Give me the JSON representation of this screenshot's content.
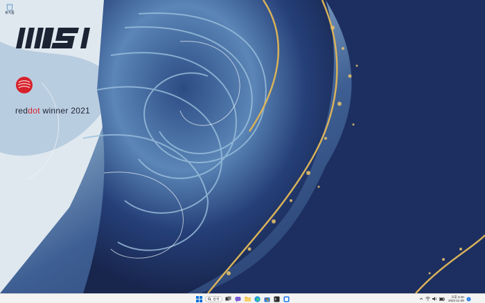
{
  "desktop": {
    "icons": [
      {
        "label": "휴지통",
        "icon": "recycle-bin-icon"
      }
    ],
    "wallpaper": {
      "brand_logo": "MSI",
      "award_text_prefix": "red",
      "award_text_highlight": "dot",
      "award_text_suffix": " winner 2021",
      "colors": {
        "navy": "#1d2f60",
        "gold": "#d9b25a",
        "brand_dark": "#1c2333",
        "red": "#d7212b"
      }
    }
  },
  "taskbar": {
    "search": {
      "label": "검색",
      "icon": "search-icon"
    },
    "pinned": [
      {
        "name": "start",
        "icon": "windows-start-icon"
      },
      {
        "name": "task-view",
        "icon": "task-view-icon"
      },
      {
        "name": "chat",
        "icon": "chat-icon"
      },
      {
        "name": "file-explorer",
        "icon": "folder-icon"
      },
      {
        "name": "edge",
        "icon": "edge-icon"
      },
      {
        "name": "store",
        "icon": "store-icon"
      },
      {
        "name": "terminal",
        "icon": "terminal-icon"
      },
      {
        "name": "settings",
        "icon": "settings-icon"
      }
    ],
    "tray": {
      "icons": [
        "chevron-up-icon",
        "wifi-icon",
        "speaker-icon",
        "battery-icon"
      ],
      "time": "오후 3:40",
      "date": "2022-11-29"
    }
  }
}
